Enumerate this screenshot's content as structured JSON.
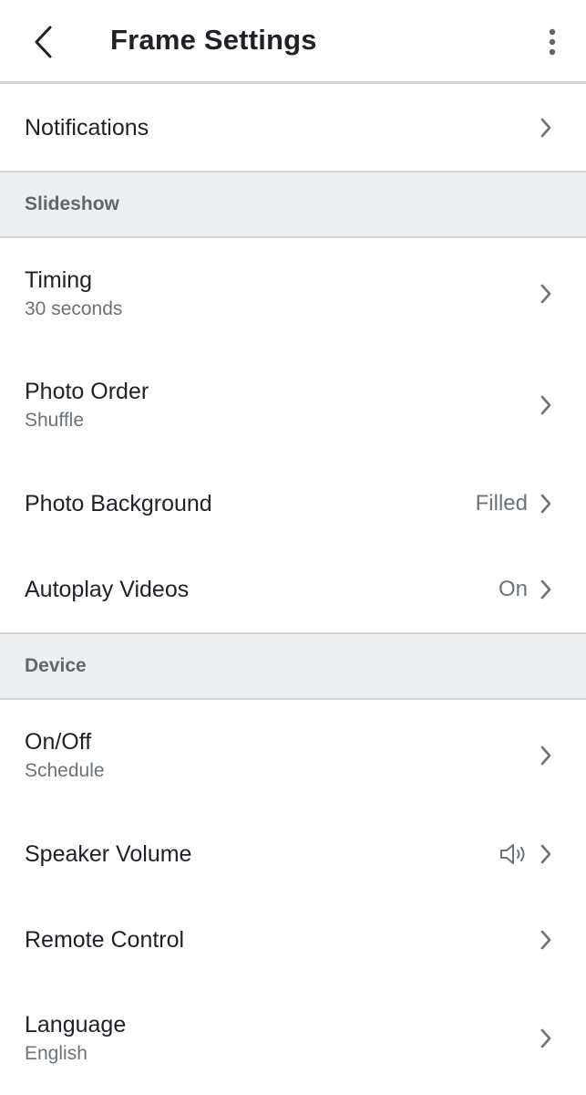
{
  "header": {
    "title": "Frame Settings",
    "back_icon": "chevron-left-icon",
    "more_icon": "more-vert-icon"
  },
  "rows_top": [
    {
      "label": "Notifications"
    }
  ],
  "sections": [
    {
      "header": "Slideshow",
      "items": [
        {
          "label": "Timing",
          "sub": "30 seconds"
        },
        {
          "label": "Photo Order",
          "sub": "Shuffle"
        },
        {
          "label": "Photo Background",
          "value": "Filled"
        },
        {
          "label": "Autoplay Videos",
          "value": "On"
        }
      ]
    },
    {
      "header": "Device",
      "items": [
        {
          "label": "On/Off",
          "sub": "Schedule"
        },
        {
          "label": "Speaker Volume",
          "value_icon": "speaker-icon"
        },
        {
          "label": "Remote Control"
        },
        {
          "label": "Language",
          "sub": "English"
        }
      ]
    }
  ],
  "colors": {
    "divider": "#cfd3d6",
    "section_bg": "#eeeff0",
    "chevron": "#6c7378"
  }
}
